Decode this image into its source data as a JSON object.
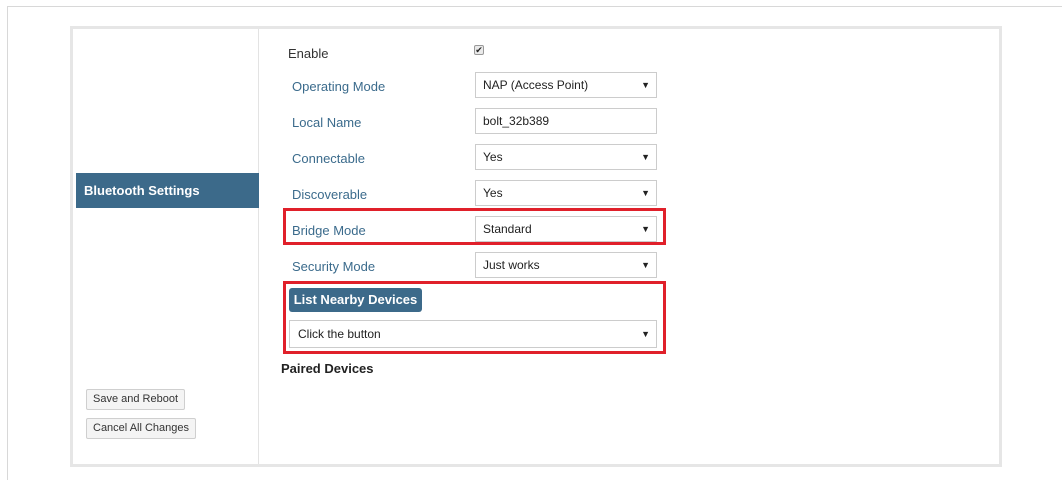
{
  "sidebar": {
    "active_item": "Bluetooth Settings",
    "save_button": "Save and Reboot",
    "cancel_button": "Cancel All Changes"
  },
  "form": {
    "enable": {
      "label": "Enable",
      "checked": true,
      "check_glyph": "✔"
    },
    "operating_mode": {
      "label": "Operating Mode",
      "value": "NAP (Access Point)"
    },
    "local_name": {
      "label": "Local Name",
      "value": "bolt_32b389"
    },
    "connectable": {
      "label": "Connectable",
      "value": "Yes"
    },
    "discoverable": {
      "label": "Discoverable",
      "value": "Yes"
    },
    "bridge_mode": {
      "label": "Bridge Mode",
      "value": "Standard"
    },
    "security_mode": {
      "label": "Security Mode",
      "value": "Just works"
    },
    "list_nearby_button": "List Nearby Devices",
    "nearby_devices_select": "Click the button",
    "paired_devices_title": "Paired Devices"
  },
  "icons": {
    "caret": "▼"
  },
  "colors": {
    "accent": "#3c6a8a",
    "highlight": "#e0202a",
    "label": "#3b6b8c"
  }
}
